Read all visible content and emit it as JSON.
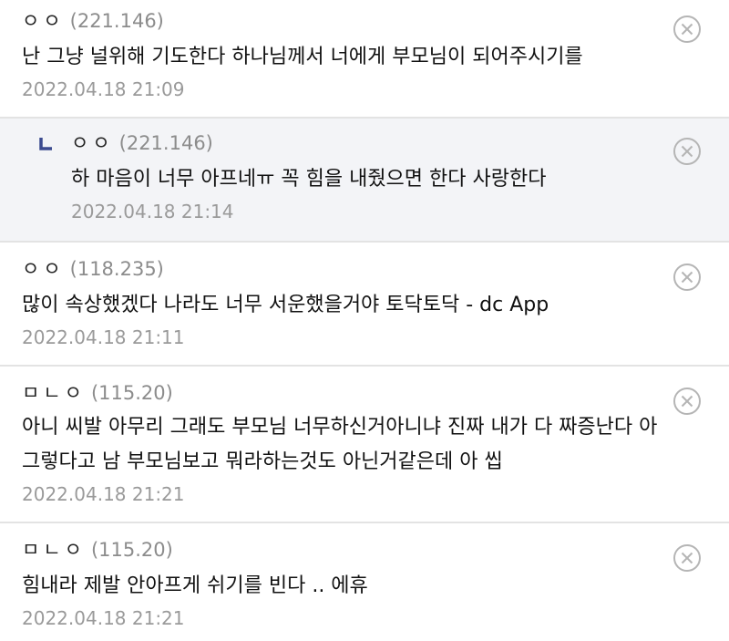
{
  "comments": [
    {
      "name": "ㅇㅇ",
      "ip": "(221.146)",
      "text": "난 그냥 널위해 기도한다 하나님께서 너에게 부모님이 되어주시기를",
      "date": "2022.04.18 21:09",
      "delete_icon": "circle-x-icon"
    },
    {
      "name": "ㅇㅇ",
      "ip": "(221.146)",
      "text": "하 마음이 너무 아프네ㅠ 꼭 힘을 내줬으면 한다 사랑한다",
      "date": "2022.04.18 21:14",
      "delete_icon": "circle-x-icon",
      "reply_icon": "reply-arrow-icon"
    },
    {
      "name": "ㅇㅇ",
      "ip": "(118.235)",
      "text": "많이 속상했겠다 나라도 너무 서운했을거야 토닥토닥 - dc App",
      "date": "2022.04.18 21:11",
      "delete_icon": "circle-x-icon"
    },
    {
      "name": "ㅁㄴㅇ",
      "ip": "(115.20)",
      "text_line1": "아니 씨발 아무리 그래도 부모님 너무하신거아니냐 진짜 내가 다 짜증난다 아",
      "text_line2": "그렇다고 남 부모님보고 뭐라하는것도 아닌거같은데 아 씹",
      "date": "2022.04.18 21:21",
      "delete_icon": "circle-x-icon"
    },
    {
      "name": "ㅁㄴㅇ",
      "ip": "(115.20)",
      "text": "힘내라 제발 안아프게 쉬기를 빈다 .. 에휴",
      "date": "2022.04.18 21:21",
      "delete_icon": "circle-x-icon"
    }
  ],
  "colors": {
    "reply_bg": "#f3f4f7",
    "reply_mark": "#3b4a8f",
    "ip_text": "#8c8c8c",
    "date_text": "#9a9a9a",
    "divider": "#e3e3e3"
  }
}
